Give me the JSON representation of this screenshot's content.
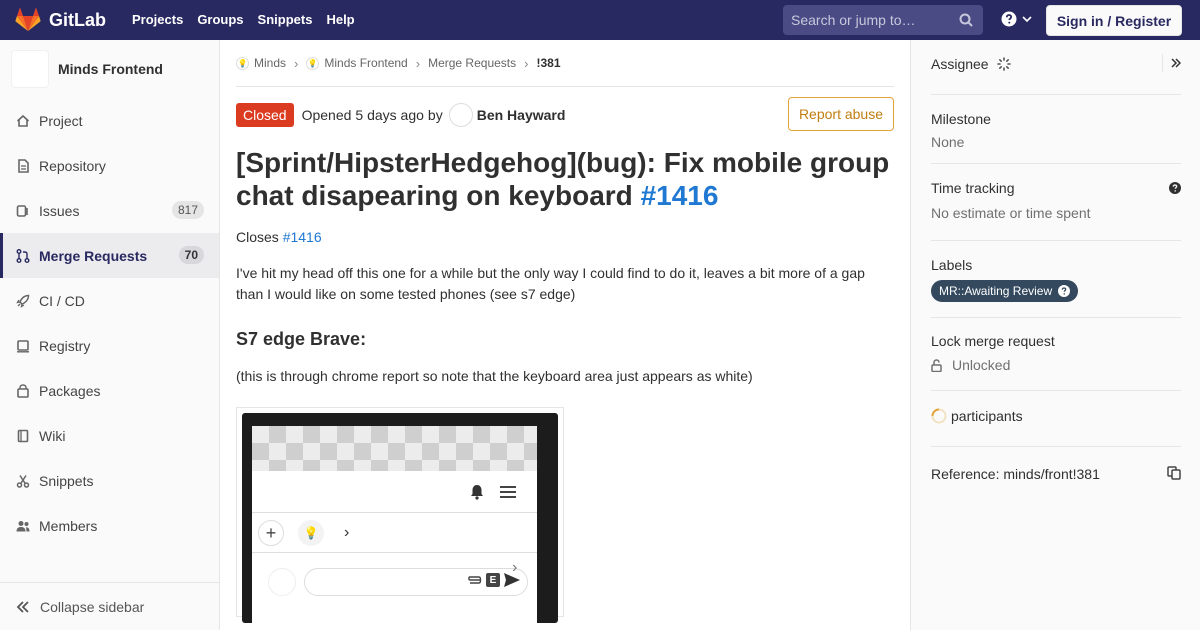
{
  "topbar": {
    "brand": "GitLab",
    "nav": [
      "Projects",
      "Groups",
      "Snippets",
      "Help"
    ],
    "search_placeholder": "Search or jump to…",
    "signin": "Sign in / Register",
    "colors": {
      "bg": "#292961",
      "accent": "#fc6d26"
    }
  },
  "sidebar": {
    "project_name": "Minds Frontend",
    "items": [
      {
        "label": "Project",
        "icon": "home-icon"
      },
      {
        "label": "Repository",
        "icon": "doc-icon"
      },
      {
        "label": "Issues",
        "icon": "issues-icon",
        "count": "817"
      },
      {
        "label": "Merge Requests",
        "icon": "merge-request-icon",
        "count": "70",
        "active": true
      },
      {
        "label": "CI / CD",
        "icon": "rocket-icon"
      },
      {
        "label": "Registry",
        "icon": "container-icon"
      },
      {
        "label": "Packages",
        "icon": "package-icon"
      },
      {
        "label": "Wiki",
        "icon": "book-icon"
      },
      {
        "label": "Snippets",
        "icon": "scissors-icon"
      },
      {
        "label": "Members",
        "icon": "users-icon"
      }
    ],
    "collapse": "Collapse sidebar"
  },
  "breadcrumb": [
    "Minds",
    "Minds Frontend",
    "Merge Requests",
    "!381"
  ],
  "mr": {
    "status": "Closed",
    "opened_prefix": "Opened",
    "opened_time": "5 days ago",
    "by": "by",
    "author": "Ben Hayward",
    "report": "Report abuse",
    "title": "[Sprint/HipsterHedgehog](bug): Fix mobile group chat disapearing on keyboard",
    "title_ref": "#1416",
    "closes_label": "Closes",
    "closes_ref": "#1416",
    "description": "I've hit my head off this one for a while but the only way I could find to do it, leaves a bit more of a gap than I would like on some tested phones (see s7 edge)",
    "heading": "S7 edge Brave:",
    "note": "(this is through chrome report so note that the keyboard area just appears as white)"
  },
  "right": {
    "assignee": "Assignee",
    "milestone_title": "Milestone",
    "milestone_value": "None",
    "time_title": "Time tracking",
    "time_value": "No estimate or time spent",
    "labels_title": "Labels",
    "label": "MR::Awaiting Review",
    "lock_title": "Lock merge request",
    "lock_value": "Unlocked",
    "participants": "participants",
    "reference": "Reference: minds/front!381"
  }
}
